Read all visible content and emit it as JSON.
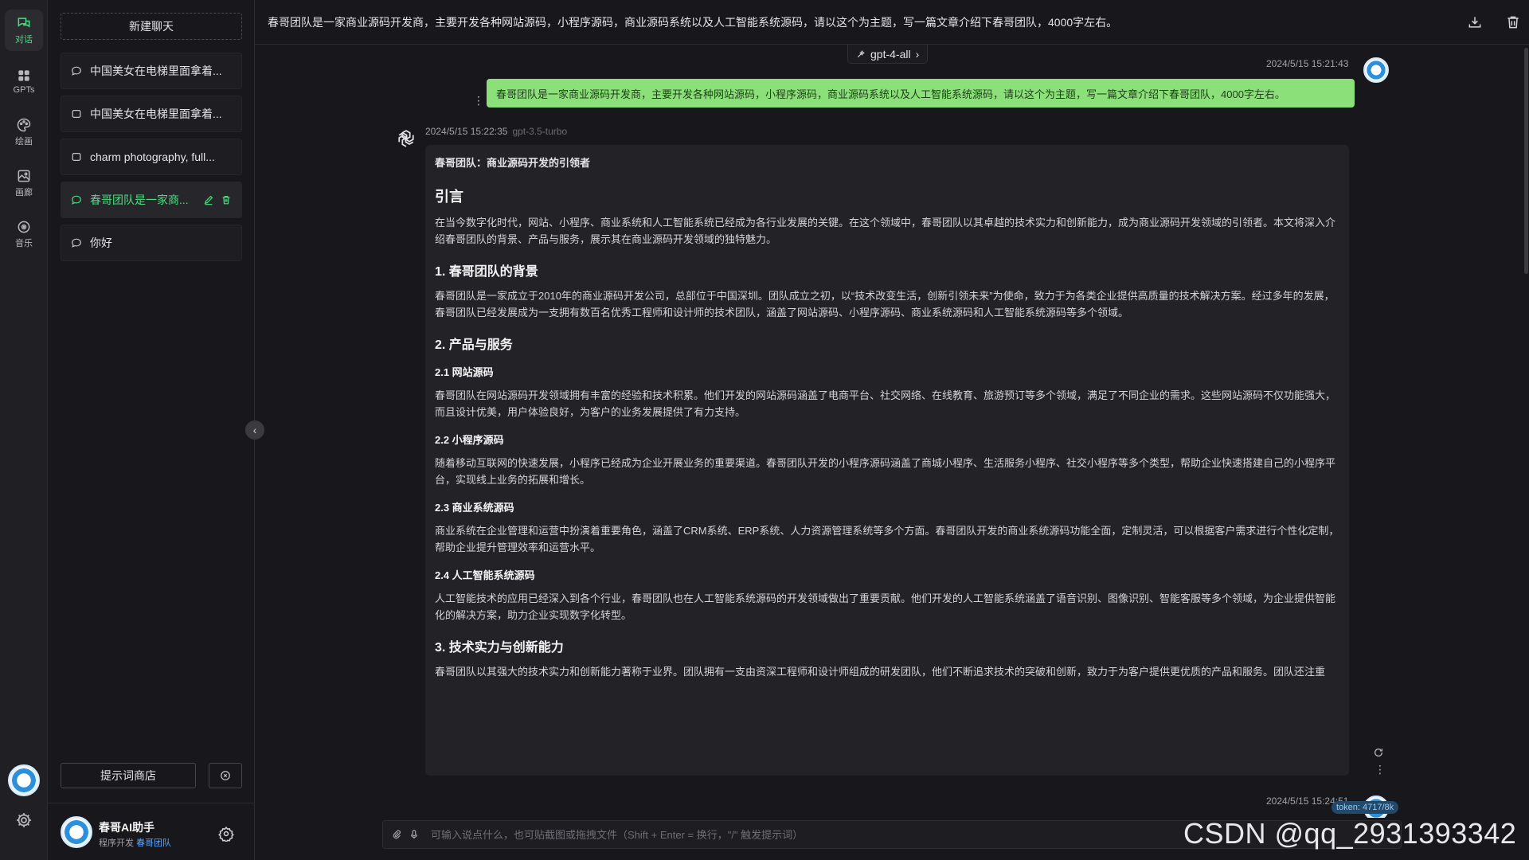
{
  "rail": {
    "items": [
      {
        "label": "对话",
        "icon": "chat-icon"
      },
      {
        "label": "GPTs",
        "icon": "grid-icon"
      },
      {
        "label": "绘画",
        "icon": "palette-icon"
      },
      {
        "label": "画廊",
        "icon": "image-icon"
      },
      {
        "label": "音乐",
        "icon": "music-icon"
      }
    ]
  },
  "sidebar": {
    "new_chat_label": "新建聊天",
    "conversations": [
      {
        "title": "中国美女在电梯里面拿着..."
      },
      {
        "title": "中国美女在电梯里面拿着..."
      },
      {
        "title": "charm photography, full..."
      },
      {
        "title": "春哥团队是一家商..."
      },
      {
        "title": "你好"
      }
    ],
    "prompt_store_label": "提示词商店",
    "profile": {
      "name": "春哥AI助手",
      "subtitle_prefix": "程序开发",
      "subtitle_link": "春哥团队"
    }
  },
  "header": {
    "title": "春哥团队是一家商业源码开发商，主要开发各种网站源码，小程序源码，商业源码系统以及人工智能系统源码，请以这个为主题，写一篇文章介绍下春哥团队，4000字左右。"
  },
  "model_selector": {
    "label": "gpt-4-all"
  },
  "messages": {
    "user": {
      "time": "2024/5/15 15:21:43",
      "text": "春哥团队是一家商业源码开发商，主要开发各种网站源码，小程序源码，商业源码系统以及人工智能系统源码，请以这个为主题，写一篇文章介绍下春哥团队，4000字左右。"
    },
    "assistant": {
      "time": "2024/5/15 15:22:35",
      "model": "gpt-3.5-turbo",
      "heading": "春哥团队：商业源码开发的引领者",
      "intro_title": "引言",
      "intro_text": "在当今数字化时代，网站、小程序、商业系统和人工智能系统已经成为各行业发展的关键。在这个领域中，春哥团队以其卓越的技术实力和创新能力，成为商业源码开发领域的引领者。本文将深入介绍春哥团队的背景、产品与服务，展示其在商业源码开发领域的独特魅力。",
      "s1_title": "1. 春哥团队的背景",
      "s1_text": "春哥团队是一家成立于2010年的商业源码开发公司，总部位于中国深圳。团队成立之初，以“技术改变生活，创新引领未来”为使命，致力于为各类企业提供高质量的技术解决方案。经过多年的发展，春哥团队已经发展成为一支拥有数百名优秀工程师和设计师的技术团队，涵盖了网站源码、小程序源码、商业系统源码和人工智能系统源码等多个领域。",
      "s2_title": "2. 产品与服务",
      "s21_title": "2.1 网站源码",
      "s21_text": "春哥团队在网站源码开发领域拥有丰富的经验和技术积累。他们开发的网站源码涵盖了电商平台、社交网络、在线教育、旅游预订等多个领域，满足了不同企业的需求。这些网站源码不仅功能强大，而且设计优美，用户体验良好，为客户的业务发展提供了有力支持。",
      "s22_title": "2.2 小程序源码",
      "s22_text": "随着移动互联网的快速发展，小程序已经成为企业开展业务的重要渠道。春哥团队开发的小程序源码涵盖了商城小程序、生活服务小程序、社交小程序等多个类型，帮助企业快速搭建自己的小程序平台，实现线上业务的拓展和增长。",
      "s23_title": "2.3 商业系统源码",
      "s23_text": "商业系统在企业管理和运营中扮演着重要角色，涵盖了CRM系统、ERP系统、人力资源管理系统等多个方面。春哥团队开发的商业系统源码功能全面，定制灵活，可以根据客户需求进行个性化定制，帮助企业提升管理效率和运营水平。",
      "s24_title": "2.4 人工智能系统源码",
      "s24_text": "人工智能技术的应用已经深入到各个行业，春哥团队也在人工智能系统源码的开发领域做出了重要贡献。他们开发的人工智能系统涵盖了语音识别、图像识别、智能客服等多个领域，为企业提供智能化的解决方案，助力企业实现数字化转型。",
      "s3_title": "3. 技术实力与创新能力",
      "s3_text": "春哥团队以其强大的技术实力和创新能力著称于业界。团队拥有一支由资深工程师和设计师组成的研发团队，他们不断追求技术的突破和创新，致力于为客户提供更优质的产品和服务。团队还注重"
    },
    "next_time": "2024/5/15 15:24:51",
    "token_badge": "token: 4717/8k"
  },
  "input": {
    "placeholder": "可输入说点什么，也可贴截图或拖拽文件（Shift + Enter = 换行，\"/\" 触发提示词）"
  },
  "watermark": "CSDN @qq_2931393342",
  "colors": {
    "accent_green": "#4ade80",
    "user_bubble": "#8ce07a",
    "background": "#18181c",
    "panel": "#232327"
  }
}
